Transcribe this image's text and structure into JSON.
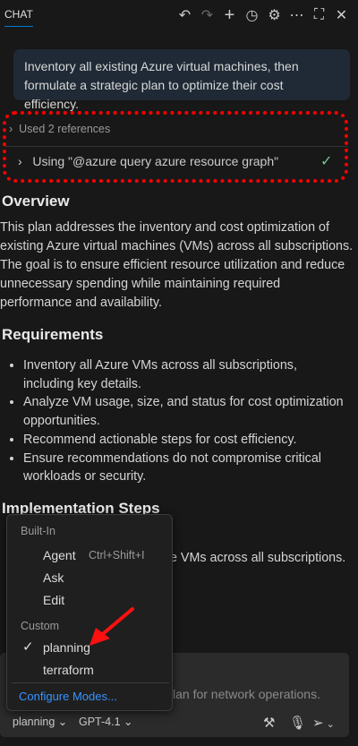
{
  "header": {
    "tab": "CHAT",
    "icons": [
      "undo-icon",
      "redo-icon",
      "plus-icon",
      "history-icon",
      "gear-icon",
      "more-icon",
      "maximize-icon",
      "close-icon"
    ]
  },
  "user_message": "Inventory all existing Azure virtual machines, then formulate a strategic plan to optimize their cost efficiency.",
  "references": {
    "used": "Used 2 references",
    "tool": "Using \"@azure query azure resource graph\""
  },
  "overview": {
    "heading": "Overview",
    "text": "This plan addresses the inventory and cost optimization of existing Azure virtual machines (VMs) across all subscriptions. The goal is to ensure efficient resource utilization and reduce unnecessary spending while maintaining required performance and availability."
  },
  "requirements": {
    "heading": "Requirements",
    "items": [
      "Inventory all Azure VMs across all subscriptions, including key details.",
      "Analyze VM usage, size, and status for cost optimization opportunities.",
      "Recommend actionable steps for cost efficiency.",
      "Ensure recommendations do not compromise critical workloads or security."
    ]
  },
  "implementation": {
    "heading": "Implementation Steps",
    "partial_line": "e VMs across all subscriptions."
  },
  "mode_menu": {
    "builtin_header": "Built-In",
    "agent": "Agent",
    "agent_shortcut": "Ctrl+Shift+I",
    "ask": "Ask",
    "edit": "Edit",
    "custom_header": "Custom",
    "planning": "planning",
    "terraform": "terraform",
    "configure": "Configure Modes...",
    "selected": "planning"
  },
  "input": {
    "placeholder_visible": "lan for network operations.",
    "mode": "planning",
    "model": "GPT-4.1"
  },
  "colors": {
    "accent": "#0078d4",
    "link": "#3794ff",
    "check": "#73c991",
    "annotation": "#ff0000"
  }
}
